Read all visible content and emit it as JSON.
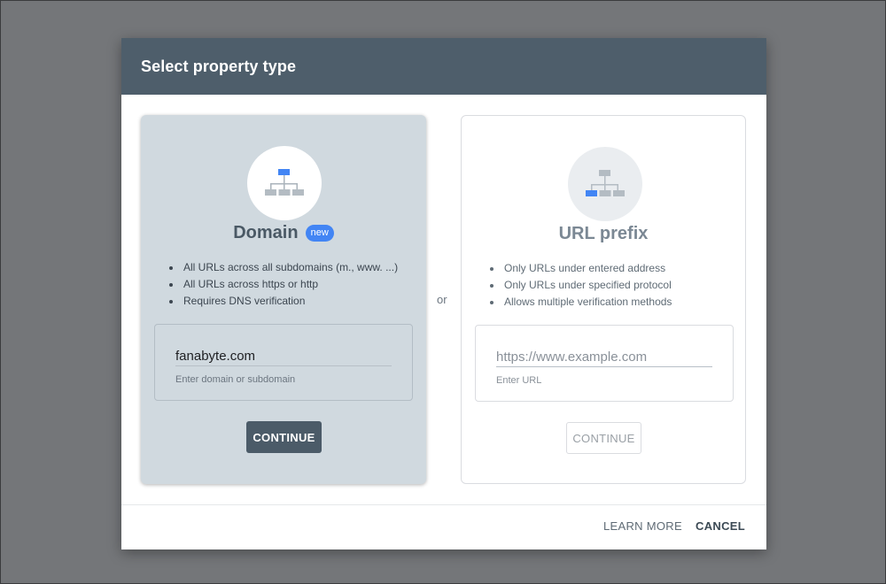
{
  "dialog": {
    "title": "Select property type"
  },
  "domain_card": {
    "title": "Domain",
    "badge": "new",
    "features": [
      "All URLs across all subdomains (m., www. ...)",
      "All URLs across https or http",
      "Requires DNS verification"
    ],
    "input_value": "fanabyte.com",
    "input_helper": "Enter domain or subdomain",
    "button_label": "CONTINUE",
    "icon": "sitemap-icon",
    "highlight_color": "#4285f4"
  },
  "divider": {
    "label": "or"
  },
  "url_card": {
    "title": "URL prefix",
    "features": [
      "Only URLs under entered address",
      "Only URLs under specified protocol",
      "Allows multiple verification methods"
    ],
    "input_placeholder": "https://www.example.com",
    "input_helper": "Enter URL",
    "button_label": "CONTINUE",
    "icon": "sitemap-icon",
    "highlight_color": "#4285f4"
  },
  "footer": {
    "learn_more_label": "LEARN MORE",
    "cancel_label": "CANCEL"
  },
  "colors": {
    "header": "#4e5e6b",
    "selected_card": "#d0d9df",
    "accent": "#4285f4",
    "overlay": "#747679"
  }
}
